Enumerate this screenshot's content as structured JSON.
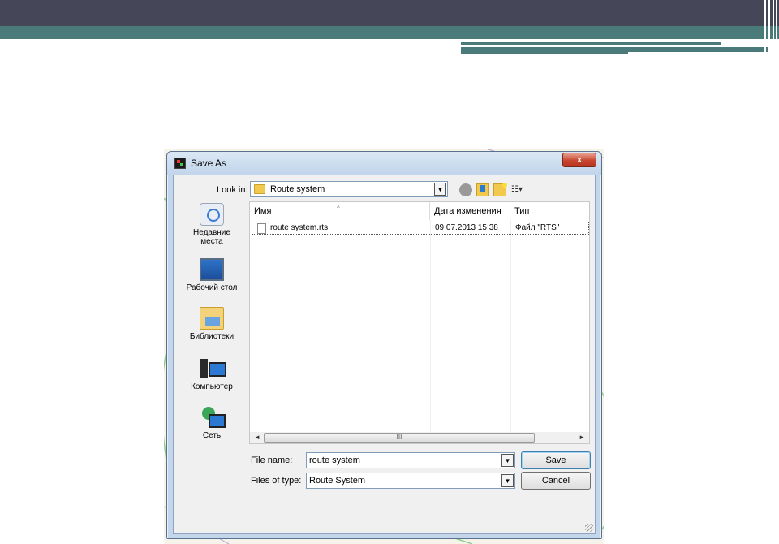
{
  "dialog": {
    "title": "Save As",
    "close_glyph": "x"
  },
  "toolbar": {
    "look_in_label": "Look in:",
    "look_in_value": "Route system",
    "view_menu_glyph": "☷▾"
  },
  "places": [
    {
      "label": "Недавние места",
      "icon": "recent-places-icon"
    },
    {
      "label": "Рабочий стол",
      "icon": "desktop-icon"
    },
    {
      "label": "Библиотеки",
      "icon": "libraries-icon"
    },
    {
      "label": "Компьютер",
      "icon": "computer-icon"
    },
    {
      "label": "Сеть",
      "icon": "network-icon"
    }
  ],
  "file_list": {
    "columns": [
      "Имя",
      "Дата изменения",
      "Тип"
    ],
    "rows": [
      {
        "name": "route system.rts",
        "modified": "09.07.2013 15:38",
        "type": "Файл \"RTS\""
      }
    ],
    "scroll_thumb_glyph": "III"
  },
  "form": {
    "file_name_label": "File name:",
    "file_name_value": "route system",
    "file_type_label": "Files of type:",
    "file_type_value": "Route System",
    "save_label": "Save",
    "cancel_label": "Cancel"
  },
  "colors": {
    "slide_top_band": "#454657",
    "slide_accent": "#4b7a7b",
    "dialog_frame": "#c4d7ea"
  }
}
